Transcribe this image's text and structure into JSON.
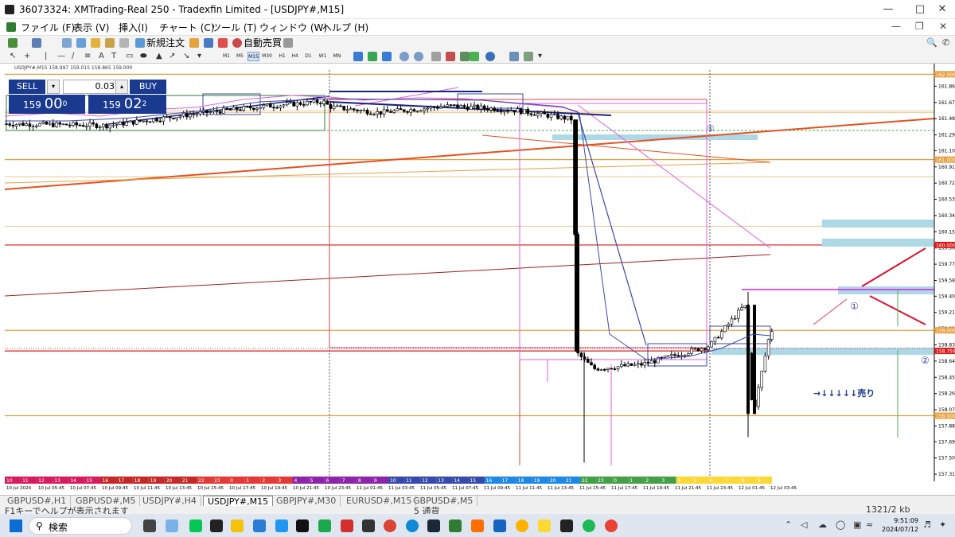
{
  "window": {
    "title": "36073324: XMTrading-Real 250 - Tradexfin Limited - [USDJPY#,M15]"
  },
  "menu": [
    "ファイル (F)",
    "表示 (V)",
    "挿入(I)",
    "チャート (C)",
    "ツール (T)",
    "ウィンドウ (W)",
    "ヘルプ (H)"
  ],
  "toolbar": {
    "new_order": "新規注文",
    "auto_trading": "自動売買"
  },
  "timeframes": [
    "M1",
    "M5",
    "M15",
    "M30",
    "H1",
    "H4",
    "D1",
    "W1",
    "MN"
  ],
  "selected_timeframe": "M15",
  "chart": {
    "header": "USDJPY#,M15 158.997 159.015 158.865 159.000",
    "trade_panel": {
      "sell_label": "SELL",
      "buy_label": "BUY",
      "lot": "0.03",
      "sell_main": "159",
      "sell_big": "00",
      "sell_sup": "0",
      "buy_main": "159",
      "buy_big": "02",
      "buy_sup": "2"
    },
    "annotations": {
      "circle1_a": "①",
      "circle1_b": "①",
      "circle2": "②",
      "sell_note": "→↓↓↓↓↓売り"
    },
    "price_tags": [
      {
        "label": "162.000",
        "color": "#e8a040",
        "price": 162.0
      },
      {
        "label": "161.000",
        "color": "#e8a040",
        "price": 161.0
      },
      {
        "label": "160.000",
        "color": "#d81b1b",
        "price": 160.0
      },
      {
        "label": "159.000",
        "color": "#e8a040",
        "price": 159.0
      },
      {
        "label": "158.759",
        "color": "#d81b1b",
        "price": 158.759
      },
      {
        "label": "158.000",
        "color": "#e8a040",
        "price": 158.0
      }
    ],
    "accent_colors": {
      "bg": "#ffffff",
      "support": "#e8a040",
      "resistance": "#d81b1b",
      "zone": "#add8e6",
      "trend": "#e8501e",
      "magenta": "#e060e0",
      "navy": "#1a237e"
    },
    "bottom_ticks": [
      "10",
      "11",
      "12",
      "13",
      "14",
      "15",
      "16",
      "17",
      "18",
      "19",
      "20",
      "21",
      "22",
      "23",
      "0",
      "1",
      "2",
      "3",
      "4",
      "5",
      "6",
      "7",
      "8",
      "9",
      "10",
      "11",
      "12",
      "13",
      "14",
      "15",
      "16",
      "17",
      "18",
      "19",
      "20",
      "21",
      "22",
      "23",
      "0",
      "1",
      "2",
      "3",
      "4",
      "5",
      "6",
      "7",
      "8",
      "9"
    ]
  },
  "chart_data": {
    "type": "candlestick",
    "title": "USDJPY#,M15",
    "y_ticks": [
      161.86,
      161.67,
      161.48,
      161.29,
      161.105,
      160.915,
      160.725,
      160.535,
      160.345,
      160.155,
      159.965,
      159.775,
      159.585,
      159.4,
      159.21,
      159.02,
      158.83,
      158.64,
      158.45,
      158.26,
      158.07,
      157.88,
      157.695,
      157.505,
      157.315
    ],
    "ylim": [
      157.25,
      162.05
    ],
    "x_labels": [
      "10 Jul 2024",
      "10 Jul 05:45",
      "10 Jul 07:45",
      "10 Jul 09:45",
      "10 Jul 11:45",
      "10 Jul 13:45",
      "10 Jul 15:45",
      "10 Jul 17:45",
      "10 Jul 19:45",
      "10 Jul 21:45",
      "10 Jul 23:45",
      "11 Jul 01:45",
      "11 Jul 03:45",
      "11 Jul 05:45",
      "11 Jul 07:45",
      "11 Jul 09:45",
      "11 Jul 11:45",
      "11 Jul 13:45",
      "11 Jul 15:45",
      "11 Jul 17:45",
      "11 Jul 19:45",
      "11 Jul 21:45",
      "11 Jul 23:45",
      "12 Jul 01:45",
      "12 Jul 03:45"
    ],
    "current_price": 159.0
  },
  "tabs": [
    "GBPUSD#,H1",
    "GBPUSD#,M5",
    "USDJPY#,H4",
    "USDJPY#,M15",
    "GBPJPY#,M30",
    "EURUSD#,M15",
    "GBPUSD#,M5"
  ],
  "active_tab": "USDJPY#,M15",
  "status": {
    "help": "F1キーでヘルプが表示されます",
    "comm": "5 通貨",
    "traffic": "1321/2 kb"
  },
  "taskbar": {
    "search": "検索",
    "time": "9:51:09",
    "date": "2024/07/12"
  }
}
